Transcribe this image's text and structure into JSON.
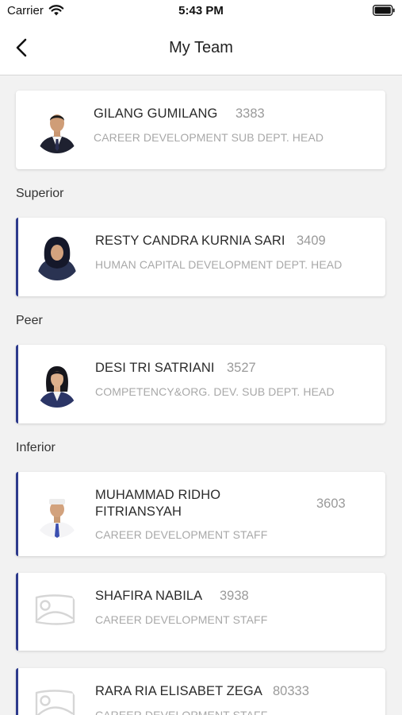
{
  "status_bar": {
    "carrier": "Carrier",
    "time": "5:43 PM"
  },
  "nav": {
    "title": "My Team",
    "back_icon": "chevron-left-icon"
  },
  "me": {
    "name": "GILANG GUMILANG",
    "nik": "3383",
    "role": "CAREER DEVELOPMENT SUB DEPT. HEAD"
  },
  "superior": {
    "label": "Superior",
    "members": [
      {
        "name": "RESTY CANDRA KURNIA SARI",
        "nik": "3409",
        "role": "HUMAN CAPITAL DEVELOPMENT DEPT. HEAD"
      }
    ]
  },
  "peer": {
    "label": "Peer",
    "members": [
      {
        "name": "DESI TRI SATRIANI",
        "nik": "3527",
        "role": "COMPETENCY&ORG. DEV. SUB DEPT. HEAD"
      }
    ]
  },
  "inferior": {
    "label": "Inferior",
    "members": [
      {
        "name_line1": "MUHAMMAD RIDHO",
        "name_line2": "FITRIANSYAH",
        "nik": "3603",
        "role": "CAREER DEVELOPMENT STAFF"
      },
      {
        "name": "SHAFIRA NABILA",
        "nik": "3938",
        "role": "CAREER DEVELOPMENT STAFF"
      },
      {
        "name": "RARA RIA ELISABET ZEGA",
        "nik": "80333",
        "role": "CAREER DEVELOPMENT STAFF"
      }
    ]
  },
  "colors": {
    "accent": "#2d3a8c",
    "background": "#f2f2f2"
  }
}
